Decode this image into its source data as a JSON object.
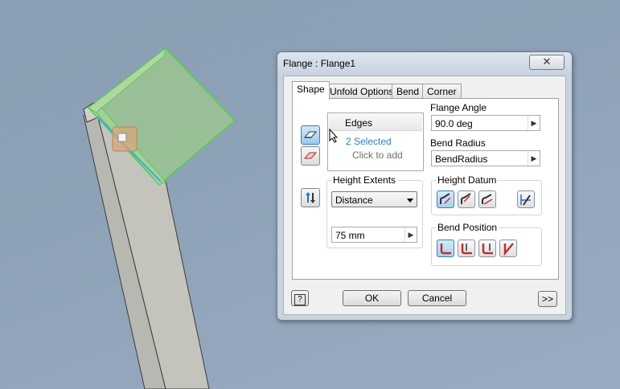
{
  "dialog": {
    "title": "Flange : Flange1",
    "close_glyph": "✕",
    "tabs": [
      {
        "label": "Shape",
        "active": true
      },
      {
        "label": "Unfold Options",
        "active": false
      },
      {
        "label": "Bend",
        "active": false
      },
      {
        "label": "Corner",
        "active": false
      }
    ],
    "edges": {
      "header": "Edges",
      "selected": "2 Selected",
      "hint": "Click to add"
    },
    "flange_angle": {
      "label": "Flange Angle",
      "value": "90.0 deg"
    },
    "bend_radius": {
      "label": "Bend Radius",
      "value": "BendRadius"
    },
    "height_extents": {
      "label": "Height Extents",
      "type": "Distance",
      "distance": "75 mm"
    },
    "height_datum": {
      "label": "Height Datum"
    },
    "bend_position": {
      "label": "Bend Position"
    },
    "buttons": {
      "ok": "OK",
      "cancel": "Cancel",
      "more": ">>",
      "help": "?"
    }
  },
  "colors": {
    "accent": "#3c7fb1",
    "selection_green": "#4fd04f",
    "link_blue": "#2a7fc4"
  }
}
